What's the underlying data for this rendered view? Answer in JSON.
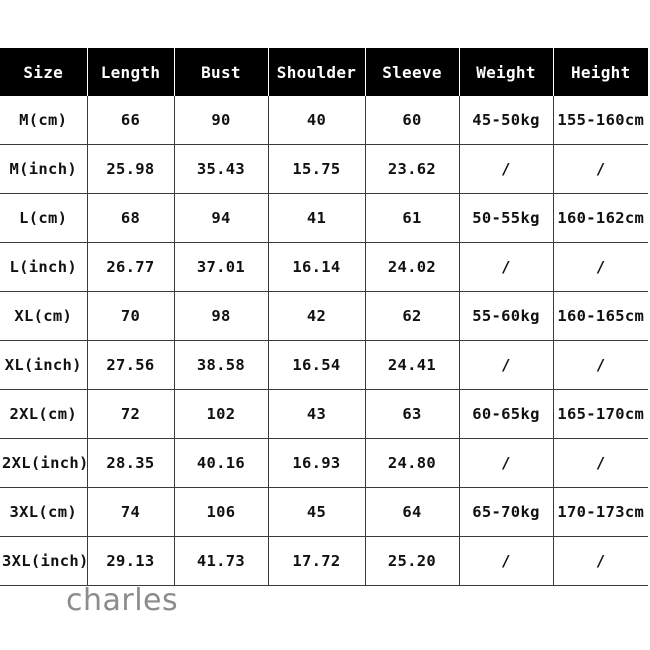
{
  "table": {
    "headers": [
      "Size",
      "Length",
      "Bust",
      "Shoulder",
      "Sleeve",
      "Weight",
      "Height"
    ],
    "rows": [
      {
        "size": "M(cm)",
        "length": "66",
        "bust": "90",
        "shoulder": "40",
        "sleeve": "60",
        "weight": "45-50kg",
        "height": "155-160cm"
      },
      {
        "size": "M(inch)",
        "length": "25.98",
        "bust": "35.43",
        "shoulder": "15.75",
        "sleeve": "23.62",
        "weight": "/",
        "height": "/"
      },
      {
        "size": "L(cm)",
        "length": "68",
        "bust": "94",
        "shoulder": "41",
        "sleeve": "61",
        "weight": "50-55kg",
        "height": "160-162cm"
      },
      {
        "size": "L(inch)",
        "length": "26.77",
        "bust": "37.01",
        "shoulder": "16.14",
        "sleeve": "24.02",
        "weight": "/",
        "height": "/"
      },
      {
        "size": "XL(cm)",
        "length": "70",
        "bust": "98",
        "shoulder": "42",
        "sleeve": "62",
        "weight": "55-60kg",
        "height": "160-165cm"
      },
      {
        "size": "XL(inch)",
        "length": "27.56",
        "bust": "38.58",
        "shoulder": "16.54",
        "sleeve": "24.41",
        "weight": "/",
        "height": "/"
      },
      {
        "size": "2XL(cm)",
        "length": "72",
        "bust": "102",
        "shoulder": "43",
        "sleeve": "63",
        "weight": "60-65kg",
        "height": "165-170cm"
      },
      {
        "size": "2XL(inch)",
        "length": "28.35",
        "bust": "40.16",
        "shoulder": "16.93",
        "sleeve": "24.80",
        "weight": "/",
        "height": "/"
      },
      {
        "size": "3XL(cm)",
        "length": "74",
        "bust": "106",
        "shoulder": "45",
        "sleeve": "64",
        "weight": "65-70kg",
        "height": "170-173cm"
      },
      {
        "size": "3XL(inch)",
        "length": "29.13",
        "bust": "41.73",
        "shoulder": "17.72",
        "sleeve": "25.20",
        "weight": "/",
        "height": "/"
      }
    ]
  },
  "watermark": {
    "text": "charles"
  },
  "colors": {
    "header_background": "#000000",
    "header_text": "#ffffff",
    "body_background": "#ffffff",
    "body_text": "#111111",
    "grid_line": "#3a3a3a",
    "watermark_text": "#8c8c8c"
  }
}
